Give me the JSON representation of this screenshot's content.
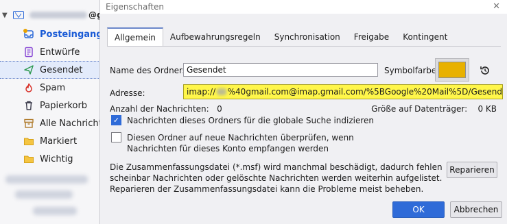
{
  "sidebar": {
    "account_suffix": "@g",
    "folders": [
      {
        "label": "Posteingang",
        "icon": "inbox-icon"
      },
      {
        "label": "Entwürfe",
        "icon": "drafts-icon"
      },
      {
        "label": "Gesendet",
        "icon": "sent-icon"
      },
      {
        "label": "Spam",
        "icon": "spam-icon"
      },
      {
        "label": "Papierkorb",
        "icon": "trash-icon"
      },
      {
        "label": "Alle Nachrichten",
        "icon": "archive-icon"
      },
      {
        "label": "Markiert",
        "icon": "folder-icon"
      },
      {
        "label": "Wichtig",
        "icon": "folder-icon"
      }
    ]
  },
  "dialog": {
    "title": "Eigenschaften",
    "tabs": [
      "Allgemein",
      "Aufbewahrungsregeln",
      "Synchronisation",
      "Freigabe",
      "Kontingent"
    ],
    "name_label": "Name des Ordners:",
    "name_value": "Gesendet",
    "color_label": "Symbolfarbe:",
    "color_value": "#e8b100",
    "address_label": "Adresse:",
    "address_prefix": "imap://",
    "address_suffix": "%40gmail.com@imap.gmail.com/%5BGoogle%20Mail%5D/Gesend",
    "count_label": "Anzahl der Nachrichten:",
    "count_value": "0",
    "size_label": "Größe auf Datenträger:",
    "size_value": "0 KB",
    "checkbox1_label": "Nachrichten dieses Ordners für die globale Suche indizieren",
    "checkbox1_checked": true,
    "checkbox2_label": "Diesen Ordner auf neue Nachrichten überprüfen, wenn Nachrichten für dieses Konto empfangen werden",
    "checkbox2_checked": false,
    "summary_text": "Die Zusammenfassungsdatei (*.msf) wird manchmal beschädigt, dadurch fehlen scheinbar Nachrichten oder gelöschte Nachrichten werden weiterhin aufgelistet. Reparieren der Zusammenfassungsdatei kann die Probleme meist beheben.",
    "repair_button": "Reparieren",
    "ok_button": "OK",
    "cancel_button": "Abbrechen"
  }
}
